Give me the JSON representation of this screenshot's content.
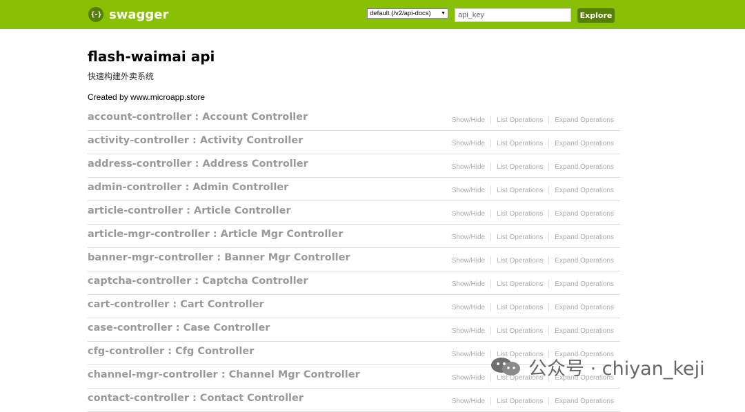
{
  "header": {
    "logo_glyph": "{-}",
    "logo_text": "swagger",
    "spec_select": "default (/v2/api-docs)",
    "api_key_placeholder": "api_key",
    "explore_label": "Explore",
    "bg_color": "#89bf04",
    "button_color": "#547f00"
  },
  "info": {
    "title": "flash-waimai api",
    "description": "快速构建外卖系统",
    "created_by": "Created by www.microapp.store"
  },
  "operations": {
    "show_hide": "Show/Hide",
    "list": "List Operations",
    "expand": "Expand Operations"
  },
  "resources": [
    "account-controller : Account Controller",
    "activity-controller : Activity Controller",
    "address-controller : Address Controller",
    "admin-controller : Admin Controller",
    "article-controller : Article Controller",
    "article-mgr-controller : Article Mgr Controller",
    "banner-mgr-controller : Banner Mgr Controller",
    "captcha-controller : Captcha Controller",
    "cart-controller : Cart Controller",
    "case-controller : Case Controller",
    "cfg-controller : Cfg Controller",
    "channel-mgr-controller : Channel Mgr Controller",
    "contact-controller : Contact Controller"
  ],
  "watermark": {
    "icon": "wechat-icon",
    "text": "公众号 · chiyan_keji"
  }
}
